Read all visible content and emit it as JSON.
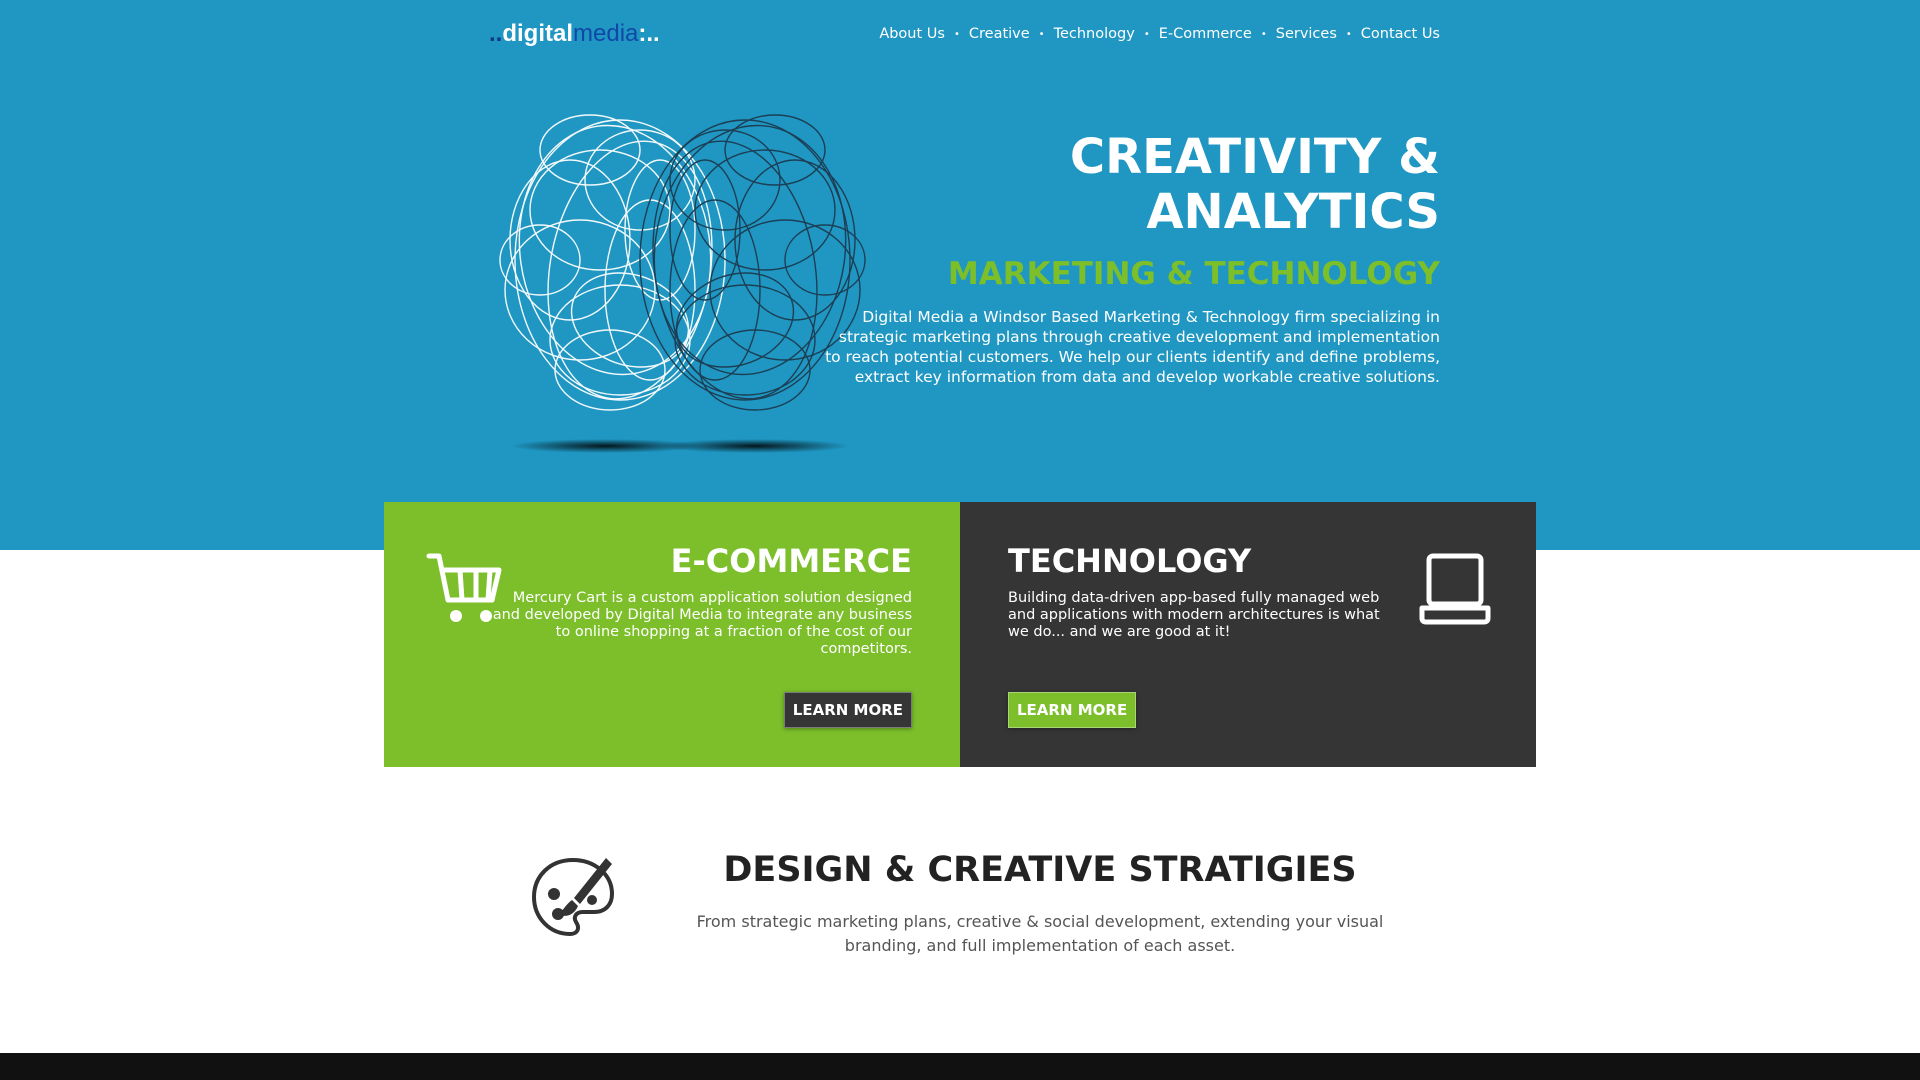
{
  "logo": {
    "dots_left": "..",
    "word1": "digital",
    "word2": "media",
    "dots_right": ":.."
  },
  "nav": {
    "items": [
      "About Us",
      "Creative",
      "Technology",
      "E-Commerce",
      "Services",
      "Contact Us"
    ],
    "separator": "•"
  },
  "hero": {
    "title_line1": "CREATIVITY &",
    "title_line2": "ANALYTICS",
    "subtitle": "MARKETING & TECHNOLOGY",
    "description": "Digital Media a Windsor Based Marketing & Technology firm specializing in strategic marketing plans through creative development and implementation to reach potential customers. We help our clients identify and define problems, extract key information from data and develop workable creative solutions.",
    "image": "brain-scribble"
  },
  "ecommerce": {
    "title": "E-COMMERCE",
    "text": "Mercury Cart is a custom application solution designed and developed by Digital Media to integrate any business to online shopping at a fraction of the cost of our competitors.",
    "button": "LEARN MORE",
    "icon": "shopping-cart-icon",
    "bg_color": "#7cbf2b"
  },
  "technology": {
    "title": "TECHNOLOGY",
    "text": "Building data-driven app-based fully managed web and applications with modern architectures is what we do... and we are good at it!",
    "button": "LEARN MORE",
    "icon": "laptop-icon",
    "bg_color": "#353535"
  },
  "design": {
    "title": "DESIGN & CREATIVE STRATIGIES",
    "text": "From strategic marketing plans, creative & social development, extending your visual branding, and full implementation of each asset.",
    "icon": "palette-icon"
  },
  "colors": {
    "hero_bg": "#1f97c2",
    "accent_green": "#7cbf2b",
    "dark": "#353535"
  }
}
